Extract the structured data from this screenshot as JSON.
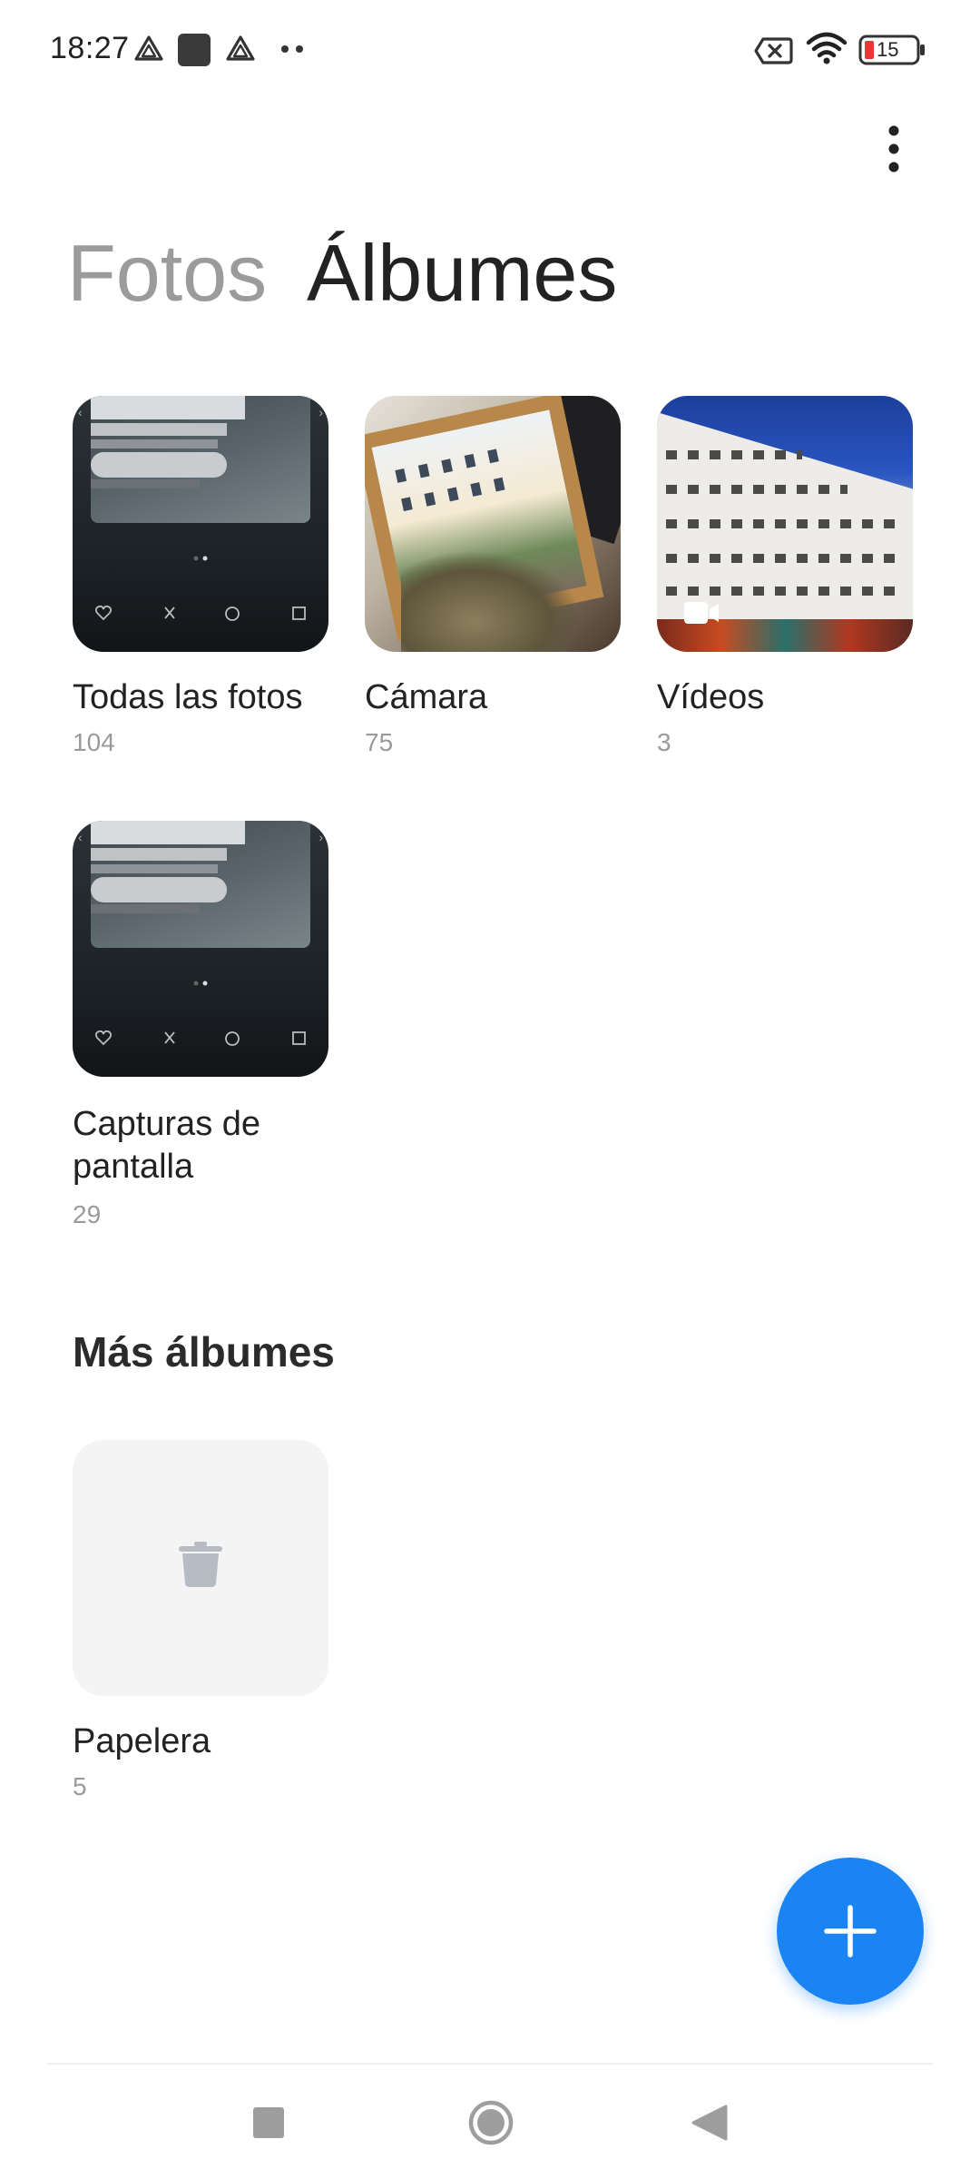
{
  "status_bar": {
    "time": "18:27",
    "battery_level": "15",
    "icons": [
      "drive-icon",
      "app-square-icon",
      "drive-icon",
      "more-notifications-icon",
      "no-sim-icon",
      "wifi-icon",
      "battery-icon"
    ],
    "battery_low_color": "#e53935"
  },
  "header": {
    "more_icon": "more-vertical-icon",
    "tabs": [
      {
        "label": "Fotos",
        "active": false
      },
      {
        "label": "Álbumes",
        "active": true
      }
    ]
  },
  "albums": [
    {
      "title": "Todas las fotos",
      "count": "104"
    },
    {
      "title": "Cámara",
      "count": "75"
    },
    {
      "title": "Vídeos",
      "count": "3"
    },
    {
      "title_line1": "Capturas de",
      "title_line2": "pantalla",
      "count": "29"
    }
  ],
  "more_albums": {
    "title": "Más álbumes",
    "items": [
      {
        "title": "Papelera",
        "count": "5",
        "icon": "trash-icon"
      }
    ]
  },
  "fab": {
    "icon": "plus-icon",
    "color": "#1a85f2"
  },
  "nav_bar": {
    "buttons": [
      "recent-apps-icon",
      "home-icon",
      "back-icon"
    ]
  }
}
